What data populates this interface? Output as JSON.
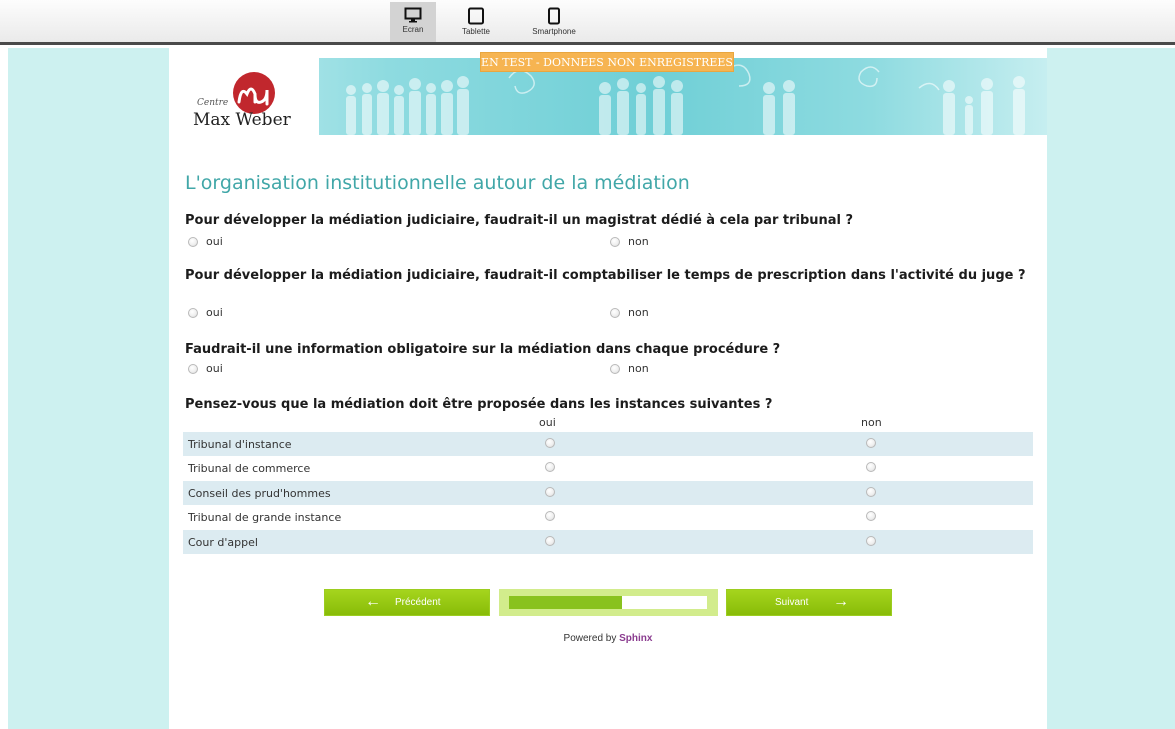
{
  "toolbar": {
    "devices": [
      {
        "label": "Ecran",
        "icon": "monitor-icon",
        "active": true
      },
      {
        "label": "Tablette",
        "icon": "tablet-icon",
        "active": false
      },
      {
        "label": "Smartphone",
        "icon": "smartphone-icon",
        "active": false
      }
    ]
  },
  "banner": {
    "logo_small": "Centre",
    "logo_big": "Max Weber",
    "test_badge": "EN TEST - DONNEES NON ENREGISTREES"
  },
  "survey": {
    "title": "L'organisation institutionnelle autour de la médiation",
    "questions": [
      {
        "text": "Pour développer la médiation judiciaire, faudrait-il un magistrat dédié à cela par tribunal ?",
        "options": [
          "oui",
          "non"
        ]
      },
      {
        "text": "Pour développer la médiation judiciaire, faudrait-il comptabiliser le temps de prescription dans l'activité du juge ?",
        "options": [
          "oui",
          "non"
        ]
      },
      {
        "text": "Faudrait-il une information obligatoire sur la médiation dans chaque procédure ?",
        "options": [
          "oui",
          "non"
        ]
      }
    ],
    "grid_question": {
      "text": "Pensez-vous que la médiation doit être proposée dans les instances suivantes ?",
      "columns": [
        "oui",
        "non"
      ],
      "rows": [
        "Tribunal d'instance",
        "Tribunal de commerce",
        "Conseil des prud'hommes",
        "Tribunal de grande instance",
        "Cour d'appel"
      ]
    }
  },
  "nav": {
    "prev_label": "Précédent",
    "next_label": "Suivant",
    "progress": 0.57
  },
  "footer": {
    "powered_by": "Powered by",
    "brand": "Sphinx"
  },
  "colors": {
    "title": "#41a7a8",
    "accent_green": "#8cc10e",
    "background": "#cdf1f0",
    "badge": "#f6b451"
  }
}
